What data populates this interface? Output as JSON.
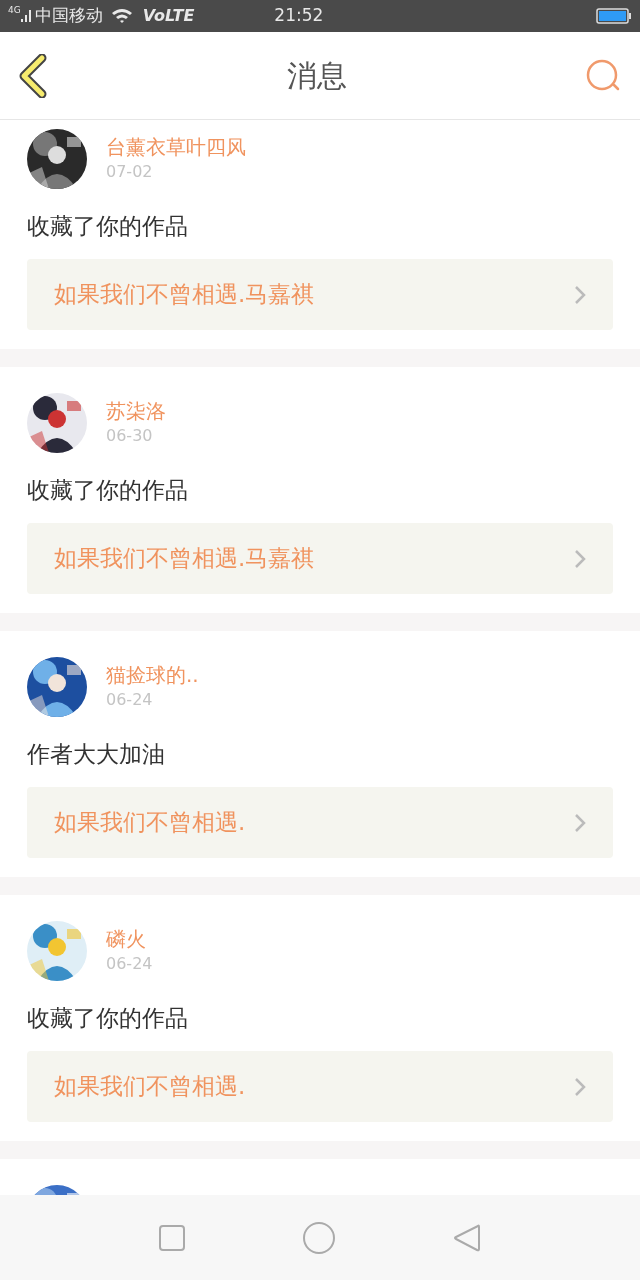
{
  "status_bar": {
    "network": "4G",
    "carrier": "中国移动",
    "volte": "VoLTE",
    "time": "21:52"
  },
  "header": {
    "title": "消息"
  },
  "messages": [
    {
      "name": "台薰衣草叶四风",
      "date": "07-02",
      "text": "收藏了你的作品",
      "work": "如果我们不曾相遇.马嘉祺",
      "avatar": {
        "kind": "picture"
      }
    },
    {
      "name": "苏柒洛",
      "date": "06-30",
      "text": "收藏了你的作品",
      "work": "如果我们不曾相遇.马嘉祺",
      "avatar": {
        "kind": "picture"
      }
    },
    {
      "name": "猫捡球的..",
      "date": "06-24",
      "text": "作者大大加油",
      "work": "如果我们不曾相遇.",
      "avatar": {
        "kind": "picture"
      }
    },
    {
      "name": "磷火",
      "date": "06-24",
      "text": "收藏了你的作品",
      "work": "如果我们不曾相遇.",
      "avatar": {
        "kind": "picture"
      }
    },
    {
      "avatar": {
        "kind": "picture"
      }
    }
  ]
}
